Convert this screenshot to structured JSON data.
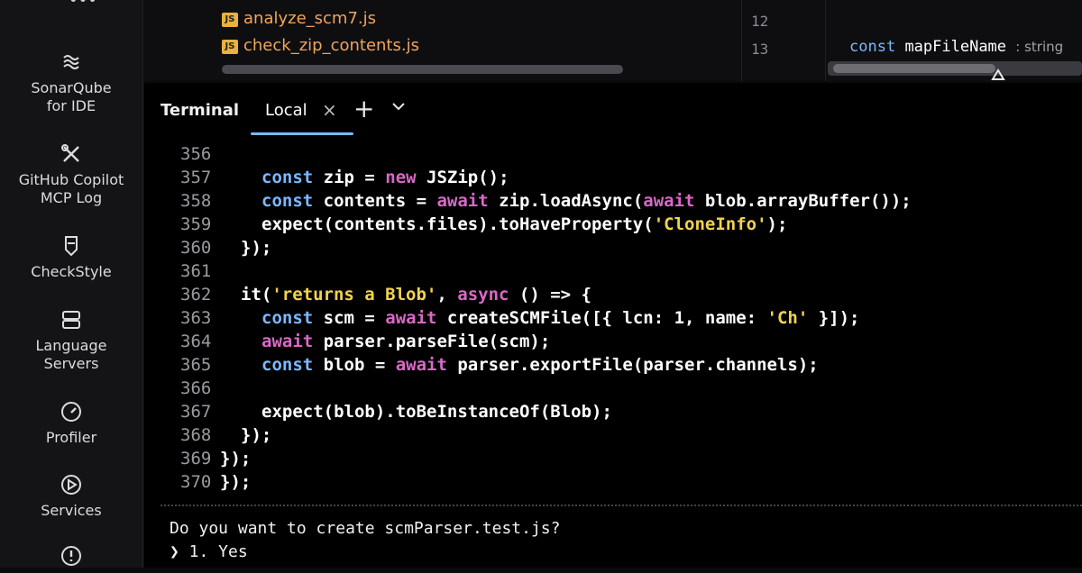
{
  "sidebar": {
    "items": [
      {
        "label": "SonarQube for IDE",
        "icon": "sonarqube-icon"
      },
      {
        "label": "GitHub Copilot MCP Log",
        "icon": "tools-icon"
      },
      {
        "label": "CheckStyle",
        "icon": "checkstyle-icon"
      },
      {
        "label": "Language Servers",
        "icon": "server-icon"
      },
      {
        "label": "Profiler",
        "icon": "gauge-icon"
      },
      {
        "label": "Services",
        "icon": "play-circle-icon"
      },
      {
        "label": "",
        "icon": "alert-circle-icon"
      }
    ]
  },
  "project_tree": {
    "files": [
      "analyze_scm7.js",
      "check_zip_contents.js"
    ],
    "file_badge": "JS"
  },
  "editor": {
    "line_numbers": [
      "12",
      "13"
    ],
    "code_keyword": "const",
    "code_identifier": "mapFileName",
    "type_hint": ": string"
  },
  "terminal": {
    "title": "Terminal",
    "tab_label": "Local",
    "close_glyph": "×",
    "add_glyph": "+",
    "lines": [
      {
        "n": "356",
        "t": ""
      },
      {
        "n": "357",
        "t": "    const zip = new JSZip();"
      },
      {
        "n": "358",
        "t": "    const contents = await zip.loadAsync(await blob.arrayBuffer());"
      },
      {
        "n": "359",
        "t": "    expect(contents.files).toHaveProperty('CloneInfo');"
      },
      {
        "n": "360",
        "t": "  });"
      },
      {
        "n": "361",
        "t": ""
      },
      {
        "n": "362",
        "t": "  it('returns a Blob', async () => {"
      },
      {
        "n": "363",
        "t": "    const scm = await createSCMFile([{ lcn: 1, name: 'Ch' }]);"
      },
      {
        "n": "364",
        "t": "    await parser.parseFile(scm);"
      },
      {
        "n": "365",
        "t": "    const blob = await parser.exportFile(parser.channels);"
      },
      {
        "n": "366",
        "t": ""
      },
      {
        "n": "367",
        "t": "    expect(blob).toBeInstanceOf(Blob);"
      },
      {
        "n": "368",
        "t": "  });"
      },
      {
        "n": "369",
        "t": "});"
      },
      {
        "n": "370",
        "t": "});"
      }
    ],
    "prompt_question": "Do you want to create scmParser.test.js?",
    "prompt_option": "❯ 1. Yes"
  },
  "colors": {
    "keyword": "#7ab8ff",
    "purple_keyword": "#d968c6",
    "string": "#f1d34f",
    "file_name": "#f0a45a",
    "tab_underline": "#7ab8ff"
  }
}
